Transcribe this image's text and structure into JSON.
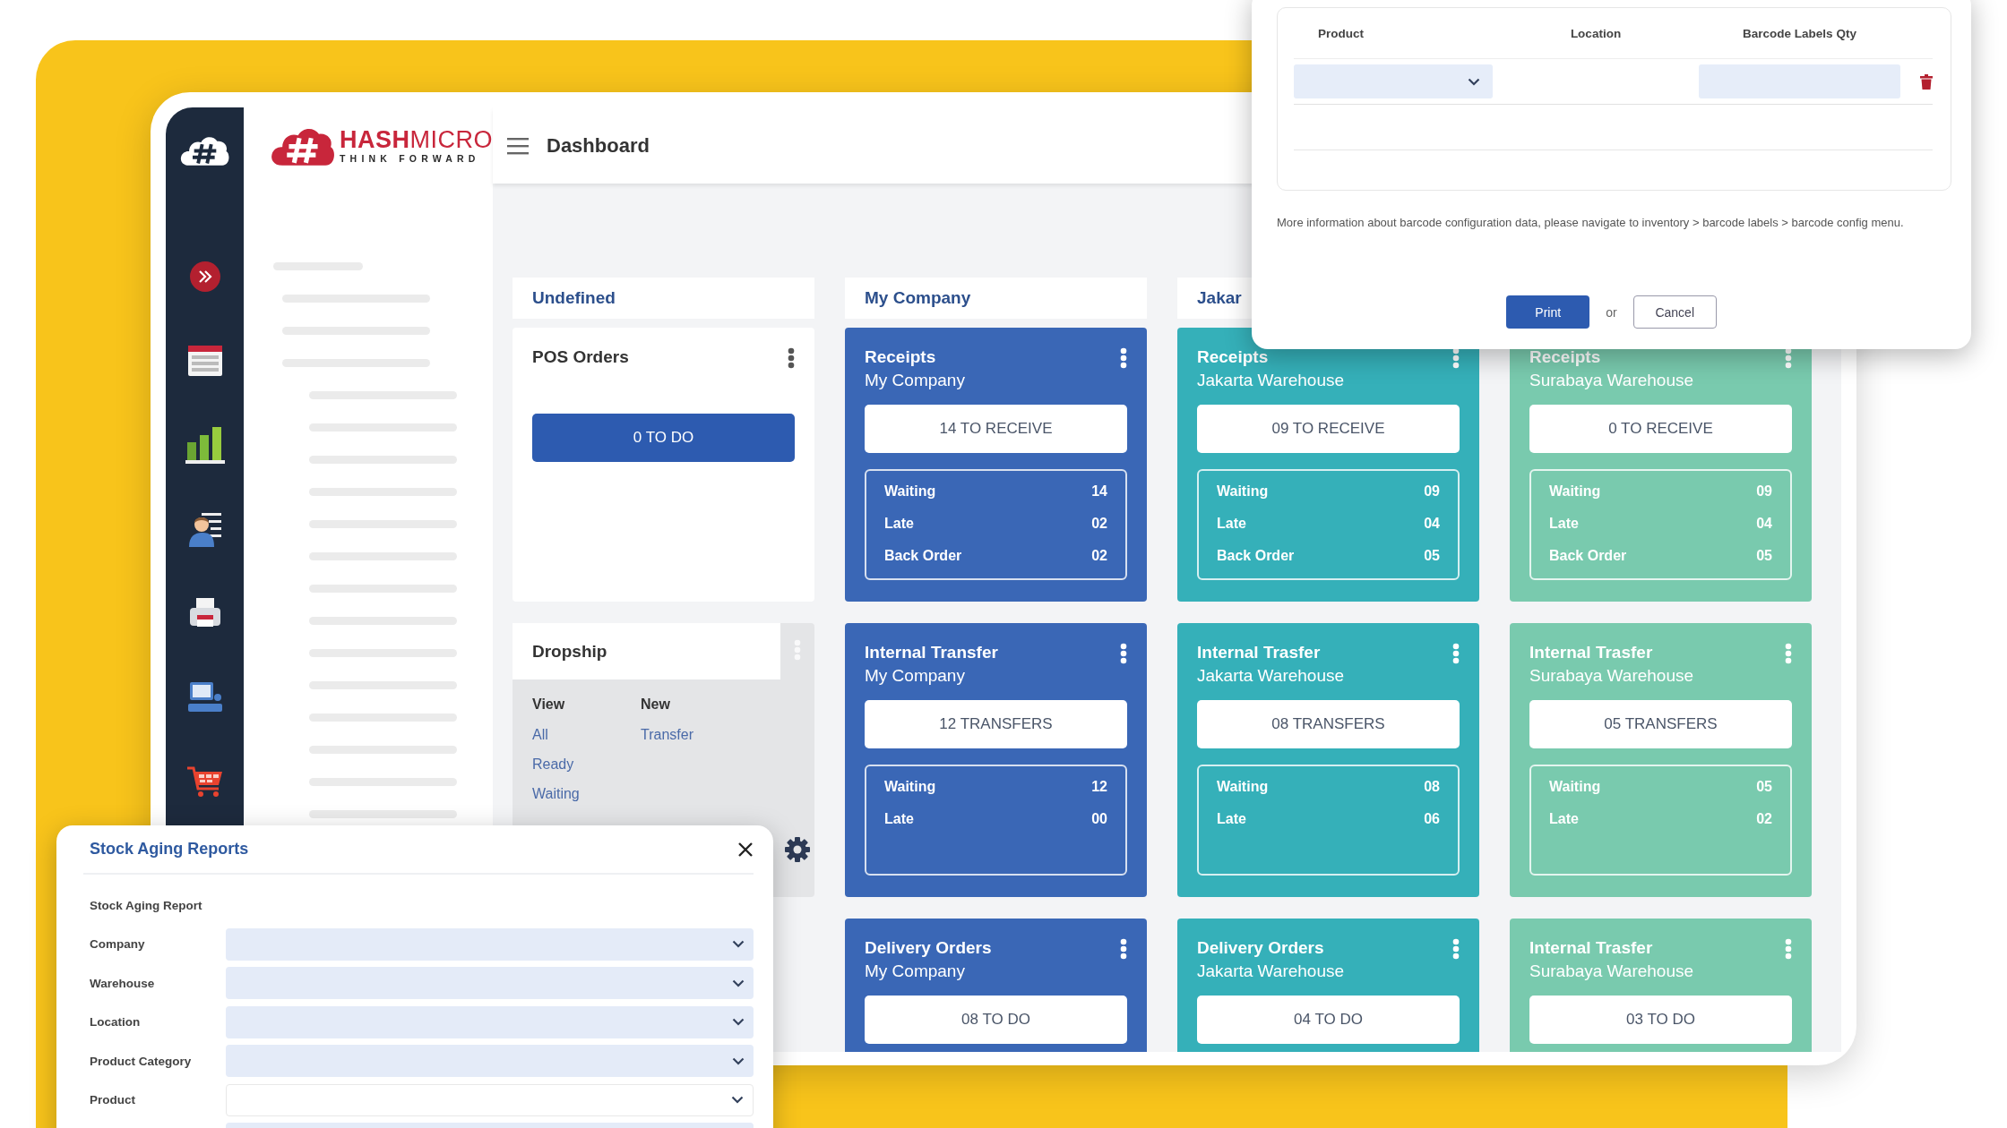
{
  "brand": {
    "name": "**HASH**MICRO",
    "tagline": "THINK FORWARD"
  },
  "header": {
    "title": "Dashboard"
  },
  "columns": [
    {
      "title": "Undefined",
      "cards": [
        {
          "kind": "action",
          "title": "POS Orders",
          "button": "0 TO DO"
        },
        {
          "kind": "menu",
          "title": "Dropship",
          "sections": [
            {
              "heading": "View",
              "links": [
                "All",
                "Ready",
                "Waiting"
              ]
            },
            {
              "heading": "New",
              "links": [
                "Transfer"
              ]
            }
          ]
        }
      ]
    },
    {
      "title": "My Company",
      "color": "#3a67b6",
      "cards": [
        {
          "kind": "stats",
          "title": "Receipts",
          "subtitle": "My Company",
          "button": "14 TO RECEIVE",
          "stats": [
            {
              "label": "Waiting",
              "value": "14"
            },
            {
              "label": "Late",
              "value": "02"
            },
            {
              "label": "Back Order",
              "value": "02"
            }
          ]
        },
        {
          "kind": "stats",
          "title": "Internal Transfer",
          "subtitle": "My Company",
          "button": "12 TRANSFERS",
          "stats": [
            {
              "label": "Waiting",
              "value": "12"
            },
            {
              "label": "Late",
              "value": "00"
            }
          ]
        },
        {
          "kind": "stats",
          "title": "Delivery Orders",
          "subtitle": "My Company",
          "button": "08 TO DO"
        }
      ]
    },
    {
      "title": "Jakar",
      "color": "#35b0b9",
      "cards": [
        {
          "kind": "stats",
          "title": "Receipts",
          "subtitle": "Jakarta Warehouse",
          "button": "09 TO RECEIVE",
          "stats": [
            {
              "label": "Waiting",
              "value": "09"
            },
            {
              "label": "Late",
              "value": "04"
            },
            {
              "label": "Back Order",
              "value": "05"
            }
          ]
        },
        {
          "kind": "stats",
          "title": "Internal Trasfer",
          "subtitle": "Jakarta Warehouse",
          "button": "08 TRANSFERS",
          "stats": [
            {
              "label": "Waiting",
              "value": "08"
            },
            {
              "label": "Late",
              "value": "06"
            }
          ]
        },
        {
          "kind": "stats",
          "title": "Delivery Orders",
          "subtitle": "Jakarta Warehouse",
          "button": "04 TO DO"
        }
      ]
    },
    {
      "color": "#79caae",
      "cards": [
        {
          "kind": "stats",
          "title": "Receipts",
          "subtitle": "Surabaya Warehouse",
          "button": "0 TO RECEIVE",
          "stats": [
            {
              "label": "Waiting",
              "value": "09"
            },
            {
              "label": "Late",
              "value": "04"
            },
            {
              "label": "Back Order",
              "value": "05"
            }
          ]
        },
        {
          "kind": "stats",
          "title": "Internal Trasfer",
          "subtitle": "Surabaya Warehouse",
          "button": "05 TRANSFERS",
          "stats": [
            {
              "label": "Waiting",
              "value": "05"
            },
            {
              "label": "Late",
              "value": "02"
            }
          ]
        },
        {
          "kind": "stats",
          "title": "Internal Trasfer",
          "subtitle": "Surabaya Warehouse",
          "button": "03 TO DO"
        }
      ]
    }
  ],
  "barcode_dialog": {
    "columns": [
      "Product",
      "Location",
      "Barcode Labels Qty"
    ],
    "note": "More information about barcode configuration data, please navigate to inventory > barcode labels > barcode config menu.",
    "print_button": "Print",
    "or": "or",
    "cancel_button": "Cancel"
  },
  "stock_dialog": {
    "title": "Stock Aging Reports",
    "section": "Stock Aging Report",
    "fields": [
      {
        "label": "Company",
        "required": true
      },
      {
        "label": "Warehouse",
        "required": true
      },
      {
        "label": "Location",
        "required": true
      },
      {
        "label": "Product Category",
        "required": true
      },
      {
        "label": "Product",
        "required": false
      },
      {
        "required": true
      }
    ]
  }
}
